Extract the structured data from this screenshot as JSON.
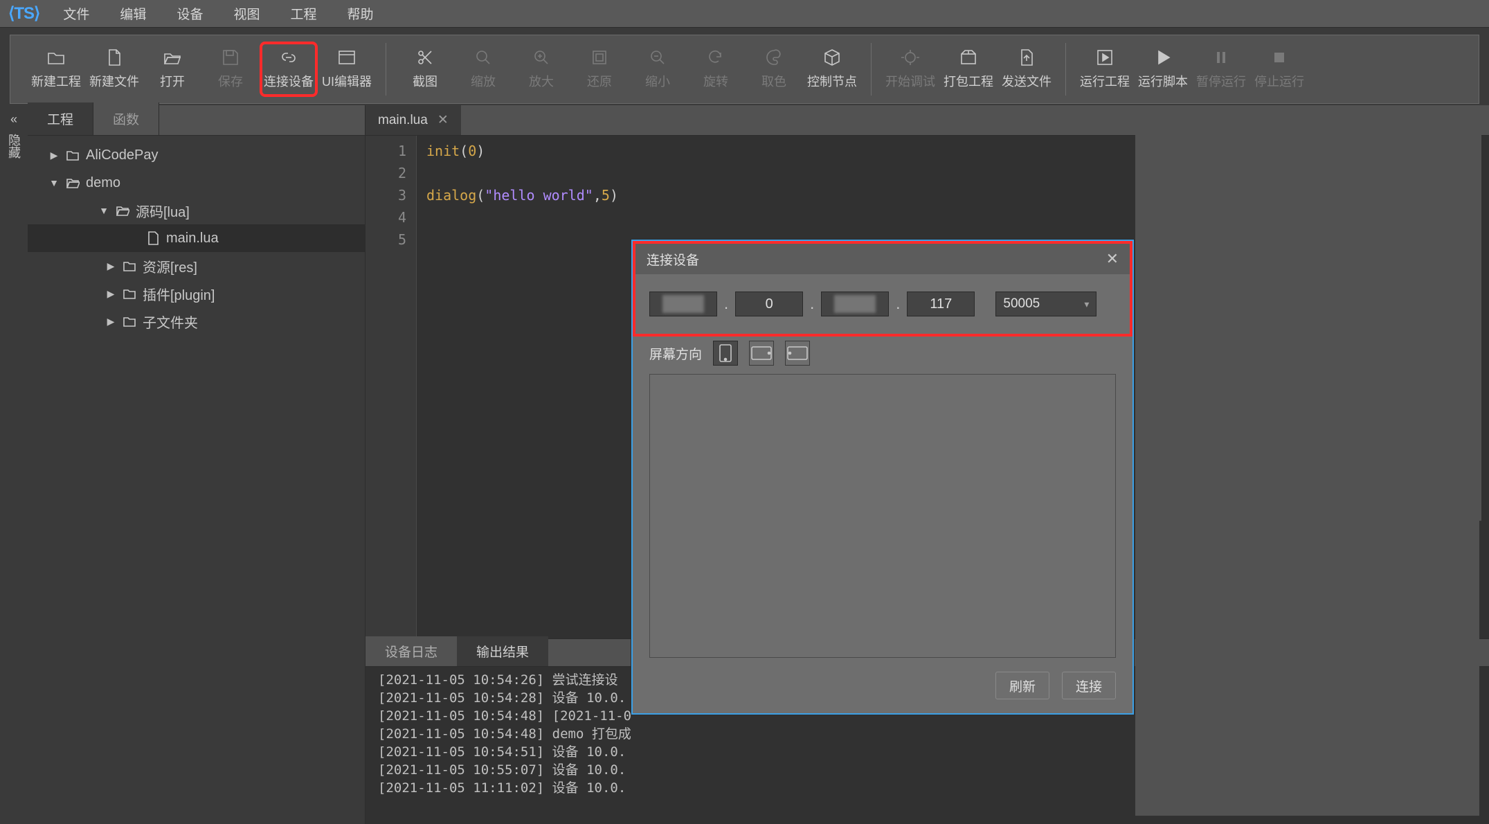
{
  "app": {
    "logo": "⟨TS⟩"
  },
  "menu": [
    "文件",
    "编辑",
    "设备",
    "视图",
    "工程",
    "帮助"
  ],
  "toolbar": {
    "groups": [
      [
        {
          "id": "new-project",
          "label": "新建工程",
          "icon": "folder",
          "dim": false
        },
        {
          "id": "new-file",
          "label": "新建文件",
          "icon": "file",
          "dim": false
        },
        {
          "id": "open",
          "label": "打开",
          "icon": "open",
          "dim": false
        },
        {
          "id": "save",
          "label": "保存",
          "icon": "save",
          "dim": true
        },
        {
          "id": "connect-device",
          "label": "连接设备",
          "icon": "link",
          "dim": false,
          "highlighted": true
        },
        {
          "id": "ui-editor",
          "label": "UI编辑器",
          "icon": "ui",
          "dim": false
        }
      ],
      [
        {
          "id": "screenshot",
          "label": "截图",
          "icon": "scissors",
          "dim": false
        },
        {
          "id": "zoom",
          "label": "缩放",
          "icon": "zoom",
          "dim": true
        },
        {
          "id": "zoom-in",
          "label": "放大",
          "icon": "zoom-in",
          "dim": true
        },
        {
          "id": "reset",
          "label": "还原",
          "icon": "reset",
          "dim": true
        },
        {
          "id": "zoom-out",
          "label": "缩小",
          "icon": "zoom-out",
          "dim": true
        },
        {
          "id": "rotate",
          "label": "旋转",
          "icon": "rotate",
          "dim": true
        },
        {
          "id": "color-pick",
          "label": "取色",
          "icon": "palette",
          "dim": true
        },
        {
          "id": "ctrl-node",
          "label": "控制节点",
          "icon": "cube",
          "dim": false
        }
      ],
      [
        {
          "id": "start-debug",
          "label": "开始调试",
          "icon": "bug",
          "dim": true
        },
        {
          "id": "pack-project",
          "label": "打包工程",
          "icon": "box",
          "dim": false
        },
        {
          "id": "send-file",
          "label": "发送文件",
          "icon": "upload",
          "dim": false
        }
      ],
      [
        {
          "id": "run-project",
          "label": "运行工程",
          "icon": "play-box",
          "dim": false
        },
        {
          "id": "run-script",
          "label": "运行脚本",
          "icon": "play",
          "dim": false
        },
        {
          "id": "pause",
          "label": "暂停运行",
          "icon": "pause",
          "dim": true
        },
        {
          "id": "stop",
          "label": "停止运行",
          "icon": "stop",
          "dim": true
        }
      ]
    ]
  },
  "sidebar": {
    "toggle_label": "隐藏",
    "tabs": [
      {
        "label": "工程",
        "active": true
      },
      {
        "label": "函数",
        "active": false
      }
    ],
    "tree": [
      {
        "depth": 1,
        "disc": "▶",
        "icon": "folder",
        "label": "AliCodePay"
      },
      {
        "depth": 1,
        "disc": "▼",
        "icon": "folder-open",
        "label": "demo"
      },
      {
        "depth": 2,
        "disc": "▼",
        "icon": "folder-open",
        "label": "源码[lua]"
      },
      {
        "depth": 3,
        "disc": "",
        "icon": "file",
        "label": "main.lua",
        "selected": true
      },
      {
        "depth": 2,
        "disc": "▶",
        "icon": "folder",
        "label": "资源[res]",
        "pad": "b"
      },
      {
        "depth": 2,
        "disc": "▶",
        "icon": "folder",
        "label": "插件[plugin]",
        "pad": "b"
      },
      {
        "depth": 2,
        "disc": "▶",
        "icon": "folder",
        "label": "子文件夹",
        "pad": "b"
      }
    ]
  },
  "editor": {
    "tab": "main.lua",
    "lines": [
      {
        "n": 1,
        "tokens": [
          [
            "fn",
            "init"
          ],
          [
            "p",
            "("
          ],
          [
            "num",
            "0"
          ],
          [
            "p",
            ")"
          ]
        ]
      },
      {
        "n": 2,
        "tokens": []
      },
      {
        "n": 3,
        "tokens": [
          [
            "fn",
            "dialog"
          ],
          [
            "p",
            "("
          ],
          [
            "str",
            "\"hello world\""
          ],
          [
            "p",
            ","
          ],
          [
            "num",
            "5"
          ],
          [
            "p",
            ")"
          ]
        ]
      },
      {
        "n": 4,
        "tokens": []
      },
      {
        "n": 5,
        "tokens": []
      }
    ]
  },
  "output": {
    "tabs": [
      {
        "label": "设备日志",
        "active": false
      },
      {
        "label": "输出结果",
        "active": true
      }
    ],
    "lines": [
      "[2021-11-05 10:54:26] 尝试连接设",
      "[2021-11-05 10:54:28] 设备 10.0.",
      "[2021-11-05 10:54:48] [2021-11-0",
      "[2021-11-05 10:54:48] demo 打包成",
      "[2021-11-05 10:54:51] 设备 10.0.",
      "[2021-11-05 10:55:07] 设备 10.0.",
      "[2021-11-05 11:11:02] 设备 10.0."
    ]
  },
  "dialog": {
    "title": "连接设备",
    "ip": [
      "",
      "0",
      "",
      "117"
    ],
    "ip_blur": [
      true,
      false,
      true,
      false
    ],
    "port": "50005",
    "orient_label": "屏幕方向",
    "buttons": {
      "refresh": "刷新",
      "connect": "连接"
    }
  }
}
